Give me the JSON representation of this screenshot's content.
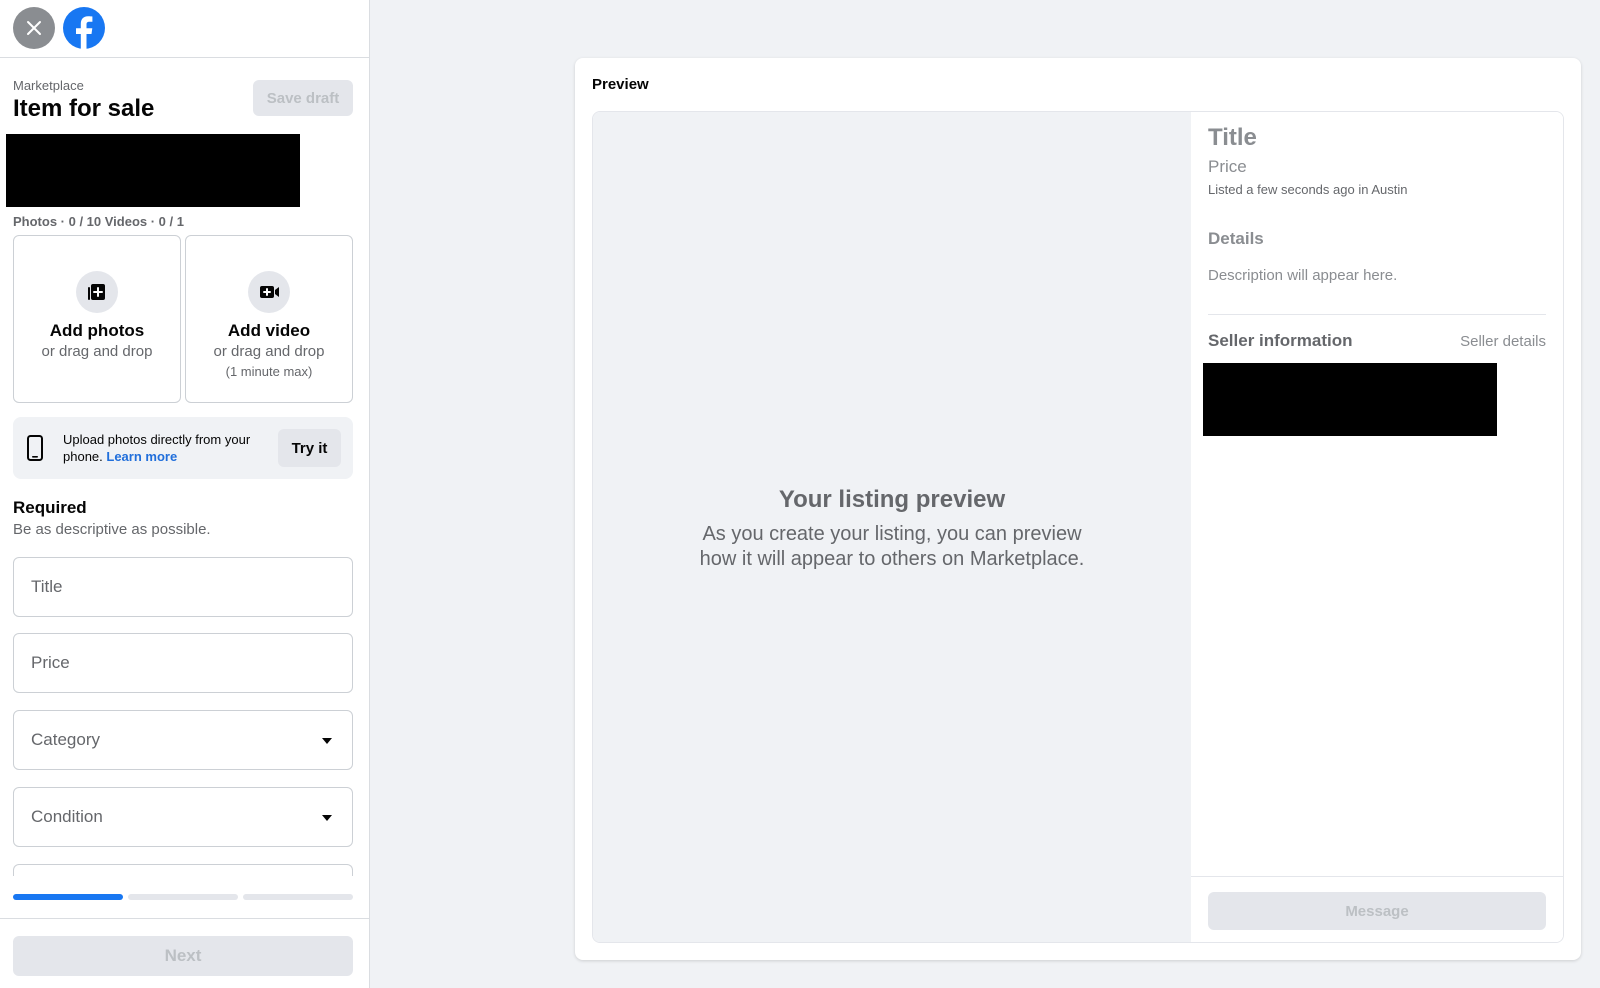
{
  "header": {
    "breadcrumb": "Marketplace",
    "title": "Item for sale",
    "save_draft": "Save draft"
  },
  "media": {
    "count_label": "Photos · 0 / 10 Videos · 0 / 1",
    "add_photos": {
      "title": "Add photos",
      "subtitle": "or drag and drop",
      "icon": "add-photo-icon"
    },
    "add_video": {
      "title": "Add video",
      "subtitle": "or drag and drop",
      "note": "(1 minute max)",
      "icon": "add-video-icon"
    }
  },
  "phone_tip": {
    "text": "Upload photos directly from your phone.",
    "link": "Learn more",
    "button": "Try it",
    "icon": "phone-icon"
  },
  "required": {
    "title": "Required",
    "subtitle": "Be as descriptive as possible."
  },
  "fields": {
    "title_placeholder": "Title",
    "price_placeholder": "Price",
    "category_placeholder": "Category",
    "condition_placeholder": "Condition"
  },
  "progress": {
    "step": 1,
    "total": 3
  },
  "footer": {
    "next": "Next"
  },
  "preview": {
    "label": "Preview",
    "heading": "Your listing preview",
    "subtext": "As you create your listing, you can preview how it will appear to others on Marketplace.",
    "title": "Title",
    "price": "Price",
    "listed": "Listed a few seconds ago in Austin",
    "details_heading": "Details",
    "description": "Description will appear here.",
    "seller_heading": "Seller information",
    "seller_link": "Seller details",
    "message_button": "Message"
  },
  "colors": {
    "brand": "#1877f2",
    "link": "#216fdb"
  }
}
